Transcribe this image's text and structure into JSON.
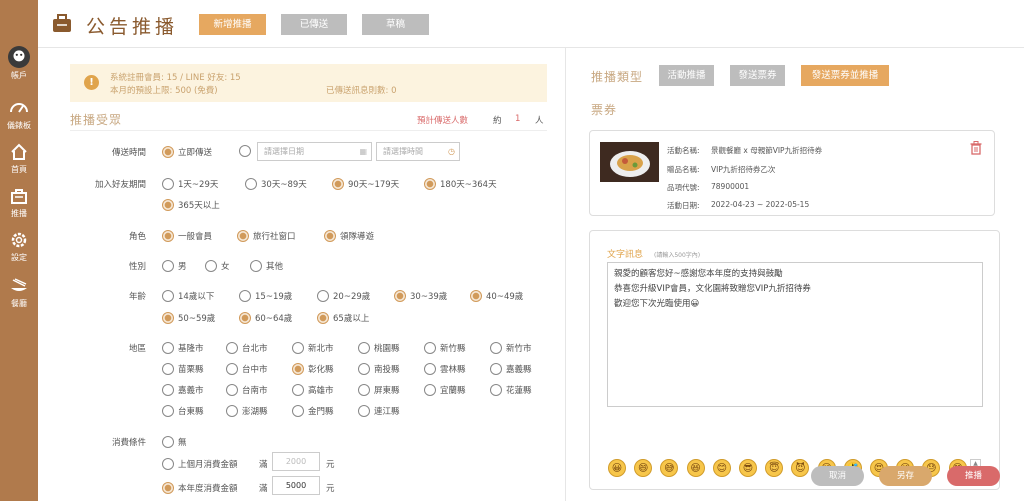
{
  "sidebar": {
    "items": [
      {
        "label": "帳戶",
        "icon": "account-icon"
      },
      {
        "label": "儀錶板",
        "icon": "dashboard-icon"
      },
      {
        "label": "首頁",
        "icon": "home-icon"
      },
      {
        "label": "推播",
        "icon": "broadcast-icon"
      },
      {
        "label": "設定",
        "icon": "gear-icon"
      },
      {
        "label": "餐廳",
        "icon": "restaurant-icon"
      }
    ]
  },
  "header": {
    "title": "公告推播",
    "tabs": [
      {
        "label": "新增推播",
        "active": true
      },
      {
        "label": "已傳送"
      },
      {
        "label": "草稿"
      }
    ]
  },
  "notice": {
    "line1": "系統註冊會員: 15 / LINE 好友: 15",
    "line2": "本月的預設上限: 500 (免費)",
    "line3": "已傳送訊息則數: 0"
  },
  "audience": {
    "title": "推播受眾",
    "estimate_label": "預計傳送人數",
    "about": "約",
    "count": "1",
    "unit": "人"
  },
  "send_time": {
    "label": "傳送時間",
    "now": "立即傳送",
    "date_placeholder": "請選擇日期",
    "time_placeholder": "請選擇時間"
  },
  "friend_period": {
    "label": "加入好友期間",
    "options": [
      "1天~29天",
      "30天~89天",
      "90天~179天",
      "180天~364天",
      "365天以上"
    ]
  },
  "role": {
    "label": "角色",
    "options": [
      "一般會員",
      "旅行社窗口",
      "領隊導遊"
    ]
  },
  "gender": {
    "label": "性別",
    "options": [
      "男",
      "女",
      "其他"
    ]
  },
  "age": {
    "label": "年齡",
    "options": [
      "14歲以下",
      "15~19歲",
      "20~29歲",
      "30~39歲",
      "40~49歲",
      "50~59歲",
      "60~64歲",
      "65歲以上"
    ]
  },
  "region": {
    "label": "地區",
    "options": [
      "基隆市",
      "台北市",
      "新北市",
      "桃園縣",
      "新竹縣",
      "新竹市",
      "苗栗縣",
      "台中市",
      "彰化縣",
      "南投縣",
      "雲林縣",
      "嘉義縣",
      "嘉義市",
      "台南市",
      "高雄市",
      "屏東縣",
      "宜蘭縣",
      "花蓮縣",
      "台東縣",
      "澎湖縣",
      "金門縣",
      "連江縣"
    ]
  },
  "spend": {
    "label": "消費條件",
    "none": "無",
    "last_month": "上個月消費金額",
    "this_year": "本年度消費金額",
    "full": "滿",
    "currency": "元",
    "last_month_value": "2000",
    "this_year_value": "5000"
  },
  "push_type": {
    "label": "推播類型",
    "options": [
      "活動推播",
      "發送票券",
      "發送票券並推播"
    ]
  },
  "ticket": {
    "title": "票券",
    "activity_label": "活動名稱:",
    "activity": "景觀餐廳 x 母親節VIP九折招待券",
    "gift_label": "贈品名稱:",
    "gift": "VIP九折招待券乙次",
    "code_label": "品項代號:",
    "code": "78900001",
    "date_label": "活動日期:",
    "dates": "2022-04-23 ~ 2022-05-15"
  },
  "message": {
    "title": "文字訊息",
    "hint": "(請輸入500字內)",
    "line1": "親愛的顧客您好~感謝您本年度的支持與鼓勵",
    "line2": "恭喜您升級VIP會員，文化園將致贈您VIP九折招待券",
    "line3": "歡迎您下次光臨使用😀"
  },
  "emojis": [
    "😀",
    "😄",
    "😅",
    "😆",
    "😊",
    "😎",
    "😇",
    "😈",
    "😉",
    "🤣",
    "😍",
    "😜",
    "😓",
    "😁"
  ],
  "footer": {
    "cancel": "取消",
    "save": "另存",
    "send": "推播"
  },
  "colors": {
    "brand": "#b07a4c",
    "accent": "#e6a860",
    "gray": "#bdbdbd",
    "danger": "#d96a6a"
  }
}
